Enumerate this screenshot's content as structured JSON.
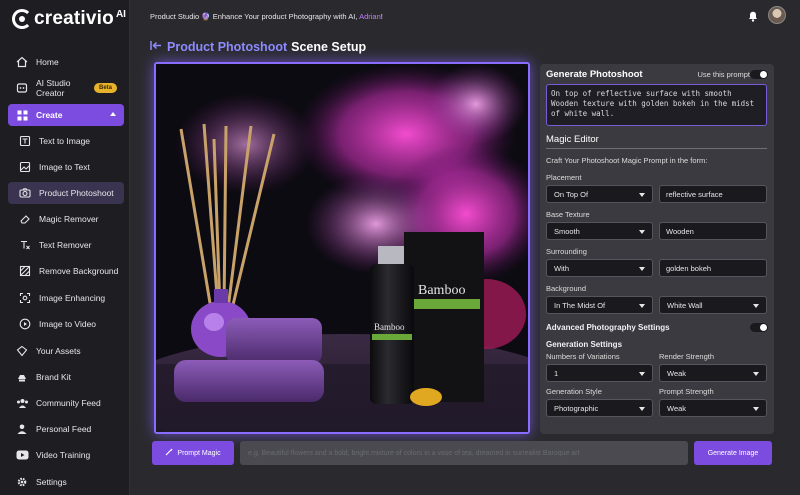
{
  "app": {
    "name": "creativio",
    "name_suffix": "AI"
  },
  "sidebar": {
    "home": "Home",
    "ai_studio": "AI Studio Creator",
    "beta": "Beta",
    "create": "Create",
    "sub_items": [
      "Text to Image",
      "Image to Text",
      "Product Photoshoot",
      "Magic Remover",
      "Text Remover",
      "Remove Background",
      "Image Enhancing",
      "Image to Video"
    ],
    "items": [
      "Your Assets",
      "Brand Kit",
      "Community Feed",
      "Personal Feed",
      "Video Training",
      "Settings"
    ]
  },
  "topbar": {
    "announce_prefix": "Product Studio 🔮 Enhance Your product Photography with AI,",
    "announce_link": "Adrian",
    "announce_suffix": "!"
  },
  "page": {
    "title_accent": "Product Photoshoot",
    "title_rest": "Scene Setup"
  },
  "product": {
    "brand": "Bamboo"
  },
  "panel": {
    "title": "Generate Photoshoot",
    "use_prompt_label": "Use this prompt",
    "prompt_text": "On top of reflective surface with smooth Wooden texture with golden bokeh in the midst of white wall.",
    "magic_editor": "Magic Editor",
    "craft_text": "Craft Your Photoshoot Magic Prompt in the form:",
    "placement": {
      "label": "Placement",
      "select": "On Top Of",
      "value": "reflective surface"
    },
    "texture": {
      "label": "Base Texture",
      "select": "Smooth",
      "value": "Wooden"
    },
    "surrounding": {
      "label": "Surrounding",
      "select": "With",
      "value": "golden bokeh"
    },
    "background": {
      "label": "Background",
      "select": "In The Midst Of",
      "value": "White Wall"
    },
    "advanced_label": "Advanced Photography Settings",
    "gen_settings": "Generation Settings",
    "variations": {
      "label": "Numbers of Variations",
      "value": "1"
    },
    "render_strength": {
      "label": "Render Strength",
      "value": "Weak"
    },
    "gen_style": {
      "label": "Generation Style",
      "value": "Photographic"
    },
    "prompt_strength": {
      "label": "Prompt Strength",
      "value": "Weak"
    }
  },
  "bottom": {
    "magic_button": "Prompt Magic",
    "input_placeholder": "e.g. Beautiful flowers and a bold, bright mixture of colors in a vase of tea, dreamed in surrealist Baroque art",
    "generate_button": "Generate Image"
  },
  "colors": {
    "accent": "#7c4ce0",
    "title_accent": "#8f8bff",
    "beta": "#e8b32a"
  }
}
